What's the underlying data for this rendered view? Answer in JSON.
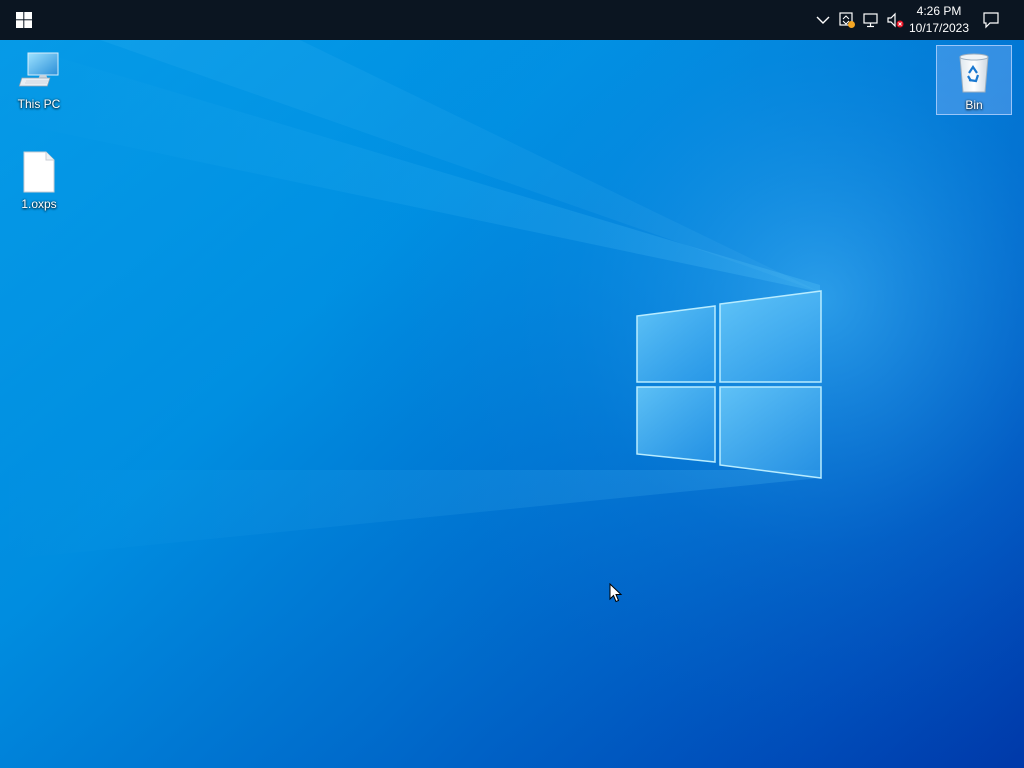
{
  "taskbar": {
    "start_icon": "windows-logo-icon",
    "tray_icons": [
      "chevron-up-icon",
      "security-warning-icon",
      "network-disconnected-icon",
      "volume-muted-icon"
    ],
    "clock": {
      "time": "4:26 PM",
      "date": "10/17/2023"
    },
    "notification_icon": "action-center-icon"
  },
  "desktop": {
    "icons": [
      {
        "label": "This PC",
        "icon": "computer-icon",
        "selected": false
      },
      {
        "label": "1.oxps",
        "icon": "document-icon",
        "selected": false
      },
      {
        "label": "Bin",
        "icon": "recycle-bin-icon",
        "selected": true
      }
    ]
  },
  "colors": {
    "taskbar": "#0b1521",
    "wallpaper_primary": "#0078d7",
    "wallpaper_light": "#00a8f0",
    "selection": "#96beff"
  }
}
